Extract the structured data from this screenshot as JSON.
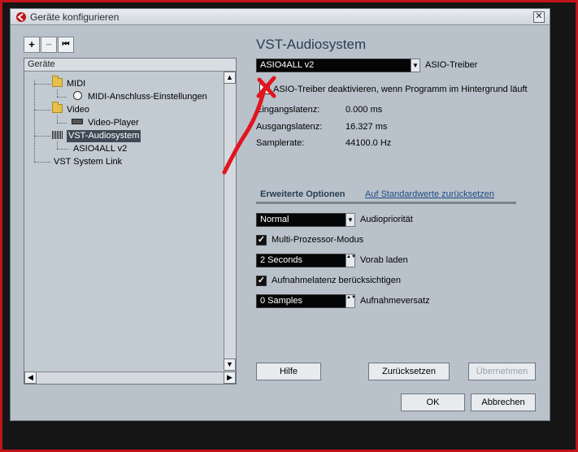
{
  "window": {
    "title": "Geräte konfigurieren",
    "close_glyph": "✕"
  },
  "toolbar": {
    "add_glyph": "+",
    "remove_glyph": "−",
    "reset_glyph": "⏮"
  },
  "tree": {
    "header": "Geräte",
    "items": [
      {
        "label": "MIDI",
        "icon": "folder-icon"
      },
      {
        "label": "MIDI-Anschluss-Einstellungen",
        "icon": "midi-port-icon"
      },
      {
        "label": "Video",
        "icon": "folder-icon"
      },
      {
        "label": "Video-Player",
        "icon": "video-player-icon"
      },
      {
        "label": "VST-Audiosystem",
        "icon": "audio-wave-icon",
        "selected": true
      },
      {
        "label": "ASIO4ALL v2"
      },
      {
        "label": "VST System Link"
      }
    ]
  },
  "scrollbar": {
    "up_glyph": "▲",
    "down_glyph": "▼",
    "left_glyph": "◀",
    "right_glyph": "▶"
  },
  "panel": {
    "title": "VST-Audiosystem",
    "driver": {
      "value": "ASIO4ALL v2",
      "label": "ASIO-Treiber"
    },
    "deactivate_checkbox": {
      "label": "ASIO-Treiber deaktivieren, wenn Programm im Hintergrund läuft",
      "checked": false
    },
    "latency": [
      {
        "label": "Eingangslatenz:",
        "value": "0.000 ms"
      },
      {
        "label": "Ausgangslatenz:",
        "value": "16.327 ms"
      },
      {
        "label": "Samplerate:",
        "value": "44100.0 Hz"
      }
    ],
    "advanced": {
      "title": "Erweiterte Optionen",
      "reset_link": "Auf Standardwerte zurücksetzen",
      "priority": {
        "value": "Normal",
        "label": "Audiopriorität"
      },
      "multiprocessor": {
        "label": "Multi-Prozessor-Modus",
        "checked": true
      },
      "preload": {
        "value": "2 Seconds",
        "label": "Vorab laden"
      },
      "record_latency": {
        "label": "Aufnahmelatenz berücksichtigen",
        "checked": true
      },
      "record_offset": {
        "value": "0 Samples",
        "label": "Aufnahmeversatz"
      }
    },
    "buttons": {
      "help": "Hilfe",
      "reset": "Zurücksetzen",
      "apply": "Übernehmen"
    }
  },
  "footer": {
    "ok": "OK",
    "cancel": "Abbrechen"
  },
  "check_glyph": "✓",
  "dropdown_arrow": "▼",
  "spinner_arrows": "▲▼",
  "colors": {
    "annotation": "#e3141e",
    "selection": "#3f4a56",
    "dialog_bg": "#b9c2cb"
  }
}
